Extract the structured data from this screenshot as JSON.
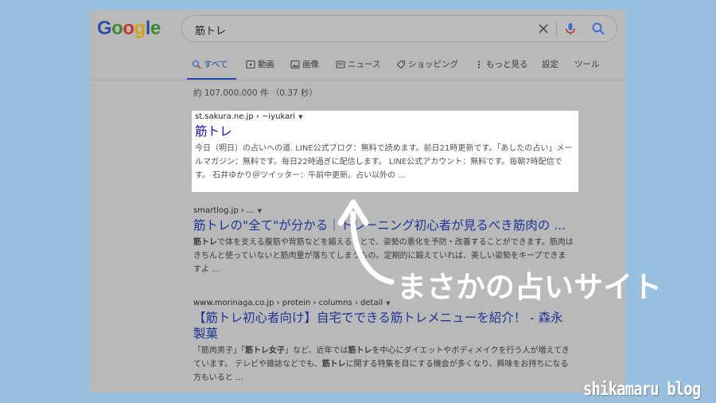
{
  "logo": {
    "text": "Google"
  },
  "search": {
    "query": "筋トレ"
  },
  "tabs": [
    {
      "label": "すべて",
      "icon": "search-icon"
    },
    {
      "label": "動画",
      "icon": "video-icon"
    },
    {
      "label": "画像",
      "icon": "image-icon"
    },
    {
      "label": "ニュース",
      "icon": "news-icon"
    },
    {
      "label": "ショッピング",
      "icon": "tag-icon"
    },
    {
      "label": "もっと見る",
      "icon": "more-icon"
    },
    {
      "label": "設定"
    },
    {
      "label": "ツール"
    }
  ],
  "result_count": "約 107,000,000 件 （0.37 秒）",
  "results": [
    {
      "url": "st.sakura.ne.jp › ~iyukari",
      "title": "筋トレ",
      "snippet": "今日（明日）の占いへの道. LINE公式ブログ：無料で読めます。前日21時更新です。「あしたの占い」メールマガジン：無料です。毎日22時過ぎに配信します。 LINE公式アカウント：無料です。毎朝7時配信です。 石井ゆかり＠ツイッター：午前中更新。占い以外の ..."
    },
    {
      "url": "smartlog.jp › ...",
      "title": "筋トレの\"全て\"が分かる｜トレーニング初心者が見るべき筋肉の ...",
      "snippet_pre": "",
      "snippet_bold": "筋トレ",
      "snippet_rest": "で体を支える腹筋や背筋などを鍛えることで、姿勢の悪化を予防・改善することができます。筋肉はきちんと使っていないと筋肉量が落ちてしまうもの。定期的に鍛えていれば、美しい姿勢をキープできますよ ..."
    },
    {
      "url": "www.morinaga.co.jp › protein › columns › detail",
      "title": "【筋トレ初心者向け】自宅でできる筋トレメニューを紹介！ - 森永製菓",
      "snippet_a": "「筋肉男子」「",
      "snippet_b": "筋トレ女子",
      "snippet_c": "」など、近年では",
      "snippet_d": "筋トレ",
      "snippet_e": "を中心にダイエットやボディメイクを行う人が増えてきています。 テレビや雑誌などでも、",
      "snippet_f": "筋トレ",
      "snippet_g": "に関する特集を目にする機会が多くなり、興味をお持ちになる方もいると ..."
    }
  ],
  "annotation": {
    "callout": "まさかの占いサイト"
  },
  "watermark": "shikamaru blog",
  "colors": {
    "background": "#98bfdd",
    "dimmed_screen": "#b9b9b9",
    "link": "#1f3596",
    "tab_active": "#1f4aa8"
  }
}
